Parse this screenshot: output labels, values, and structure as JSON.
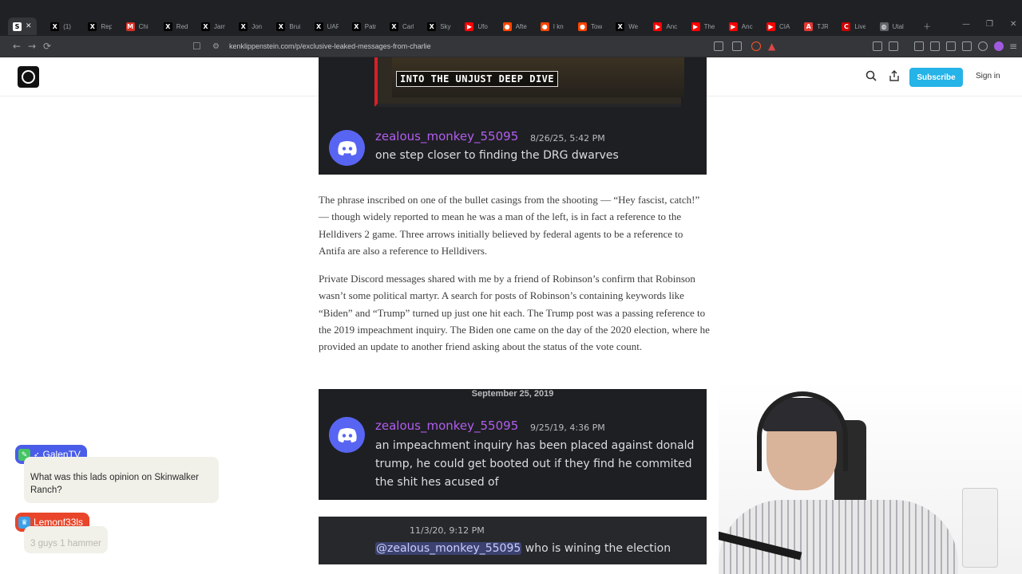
{
  "browser": {
    "tabs": [
      {
        "icon": "substack-icon",
        "title": "",
        "color": "#ffffff",
        "glyph": "S"
      },
      {
        "icon": "x-icon",
        "title": "(1)",
        "color": "#000000",
        "glyph": "X"
      },
      {
        "icon": "x-icon",
        "title": "Rep",
        "color": "#000000",
        "glyph": "X"
      },
      {
        "icon": "gmail-icon",
        "title": "Chi",
        "color": "#d93025",
        "glyph": "M"
      },
      {
        "icon": "x-icon",
        "title": "Red",
        "color": "#000000",
        "glyph": "X"
      },
      {
        "icon": "x-icon",
        "title": "Jam",
        "color": "#000000",
        "glyph": "X"
      },
      {
        "icon": "x-icon",
        "title": "Jon",
        "color": "#000000",
        "glyph": "X"
      },
      {
        "icon": "x-icon",
        "title": "Brui",
        "color": "#000000",
        "glyph": "X"
      },
      {
        "icon": "x-icon",
        "title": "UAF",
        "color": "#000000",
        "glyph": "X"
      },
      {
        "icon": "x-icon",
        "title": "Patr",
        "color": "#000000",
        "glyph": "X"
      },
      {
        "icon": "x-icon",
        "title": "Carl",
        "color": "#000000",
        "glyph": "X"
      },
      {
        "icon": "x-icon",
        "title": "Sky",
        "color": "#000000",
        "glyph": "X"
      },
      {
        "icon": "youtube-icon",
        "title": "Ufo",
        "color": "#ff0000",
        "glyph": "▶"
      },
      {
        "icon": "reddit-icon",
        "title": "Afte",
        "color": "#ff4500",
        "glyph": "●"
      },
      {
        "icon": "reddit-icon",
        "title": "I kn",
        "color": "#ff4500",
        "glyph": "●"
      },
      {
        "icon": "reddit-icon",
        "title": "Tow",
        "color": "#ff4500",
        "glyph": "●"
      },
      {
        "icon": "x-icon",
        "title": "We",
        "color": "#000000",
        "glyph": "X"
      },
      {
        "icon": "youtube-icon",
        "title": "Anc",
        "color": "#ff0000",
        "glyph": "▶"
      },
      {
        "icon": "youtube-icon",
        "title": "The",
        "color": "#ff0000",
        "glyph": "▶"
      },
      {
        "icon": "youtube-icon",
        "title": "Anc",
        "color": "#ff0000",
        "glyph": "▶"
      },
      {
        "icon": "youtube-icon",
        "title": "CIA",
        "color": "#ff0000",
        "glyph": "▶"
      },
      {
        "icon": "pdf-icon",
        "title": "TJR",
        "color": "#e53935",
        "glyph": "A"
      },
      {
        "icon": "cnn-icon",
        "title": "Live",
        "color": "#cc0000",
        "glyph": "C"
      },
      {
        "icon": "globe-icon",
        "title": "Utal",
        "color": "#5f6368",
        "glyph": "◍"
      }
    ],
    "url": "kenklippenstein.com/p/exclusive-leaked-messages-from-charlie"
  },
  "site": {
    "subscribe_label": "Subscribe",
    "signin_label": "Sign in"
  },
  "article": {
    "embed1": {
      "video_caption": "INTO THE UNJUST DEEP DIVE",
      "username": "zealous_monkey_55095",
      "timestamp": "8/26/25, 5:42 PM",
      "message": "one step closer to finding the DRG dwarves"
    },
    "para1": "The phrase inscribed on one of the bullet casings from the shooting — “Hey fascist, catch!” — though widely reported to mean he was a man of the left, is in fact a reference to the Helldivers 2 game. Three arrows initially believed by federal agents to be a reference to Antifa are also a reference to Helldivers.",
    "para2": "Private Discord messages shared with me by a friend of Robinson’s confirm that Robinson wasn’t some political martyr. A search for posts of Robinson’s containing keywords like “Biden” and “Trump” turned up just one hit each. The Trump post was a passing reference to the 2019 impeachment inquiry. The Biden one came on the day of the 2020 election, where he provided an update to another friend asking about the status of the vote count.",
    "embed2": {
      "date_header": "September 25, 2019",
      "username": "zealous_monkey_55095",
      "timestamp": "9/25/19, 4:36 PM",
      "message": "an impeachment inquiry has been placed against donald trump, he could get booted out if they find he commited the shit hes acused of"
    },
    "embed3": {
      "timestamp": "11/3/20, 9:12 PM",
      "mention": "@zealous_monkey_55095",
      "message": " who is wining the election"
    }
  },
  "stream_chat": [
    {
      "user": "GalenTV",
      "badge_color": "#4a5de8",
      "message": "What was this lads opinion on Skinwalker Ranch?",
      "faded": false
    },
    {
      "user": "Lemonf33ls",
      "badge_color": "#e8452a",
      "message": "3 guys 1 hammer",
      "faded": true
    }
  ],
  "colors": {
    "discord_blurple": "#5865f2",
    "discord_user": "#b25ef0",
    "subscribe": "#26b3e7"
  }
}
